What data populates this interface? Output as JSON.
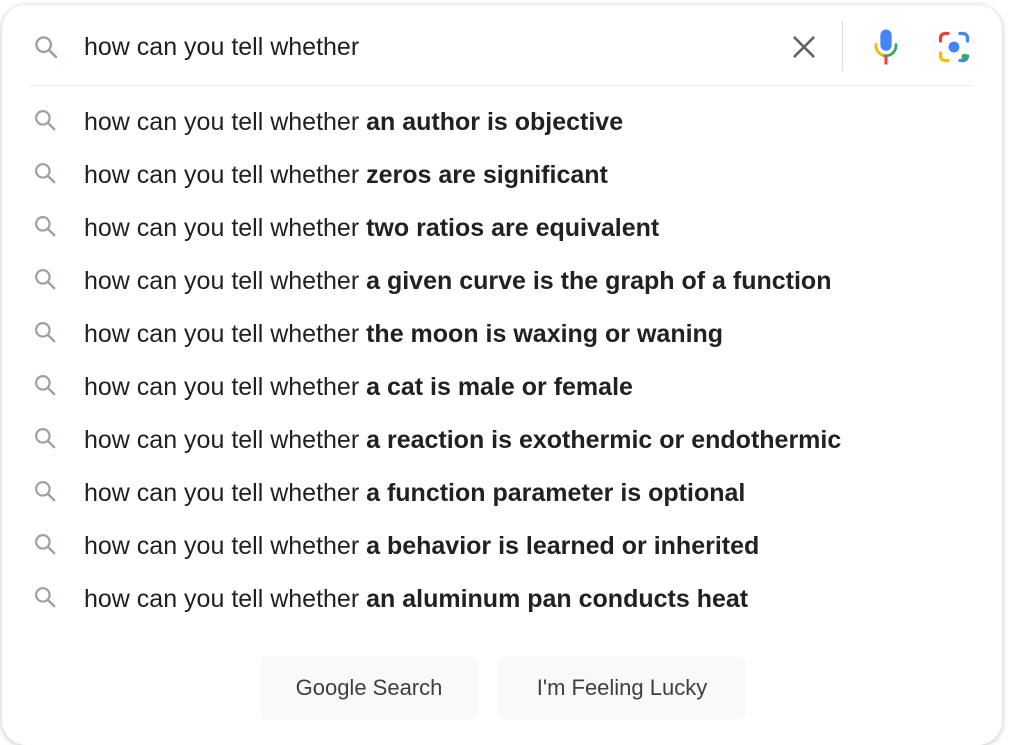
{
  "search": {
    "query": "how can you tell whether",
    "icons": {
      "search": "search-icon",
      "clear": "close-icon",
      "voice": "microphone-icon",
      "lens": "camera-lens-icon"
    }
  },
  "suggestions": [
    {
      "prefix": "how can you tell whether ",
      "completion": "an author is objective"
    },
    {
      "prefix": "how can you tell whether ",
      "completion": "zeros are significant"
    },
    {
      "prefix": "how can you tell whether ",
      "completion": "two ratios are equivalent"
    },
    {
      "prefix": "how can you tell whether ",
      "completion": "a given curve is the graph of a function"
    },
    {
      "prefix": "how can you tell whether ",
      "completion": "the moon is waxing or waning"
    },
    {
      "prefix": "how can you tell whether ",
      "completion": "a cat is male or female"
    },
    {
      "prefix": "how can you tell whether ",
      "completion": "a reaction is exothermic or endothermic"
    },
    {
      "prefix": "how can you tell whether ",
      "completion": "a function parameter is optional"
    },
    {
      "prefix": "how can you tell whether ",
      "completion": "a behavior is learned or inherited"
    },
    {
      "prefix": "how can you tell whether ",
      "completion": "an aluminum pan conducts heat"
    }
  ],
  "buttons": {
    "google_search": "Google Search",
    "feeling_lucky": "I'm Feeling Lucky"
  },
  "colors": {
    "text": "#202124",
    "icon_gray": "#9aa0a6",
    "mic_blue": "#4285f4",
    "mic_red": "#ea4335",
    "lens_yellow": "#fbbc04",
    "lens_green": "#34a853",
    "button_bg": "#f8f9fa"
  }
}
